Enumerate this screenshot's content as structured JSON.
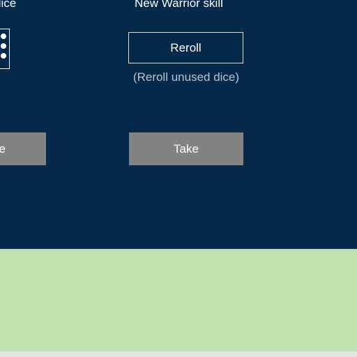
{
  "headings": {
    "left": "dice",
    "center": "New Warrior skill"
  },
  "dice": {
    "icon": "dice-icon"
  },
  "reroll": {
    "label": "Reroll",
    "hint": "(Reroll unused dice)"
  },
  "buttons": {
    "left_label": "e",
    "take_label": "Take"
  },
  "colors": {
    "panel_background": "#04294a",
    "bottom_panel": "#c0e1b0",
    "button_gray": "#838383"
  }
}
